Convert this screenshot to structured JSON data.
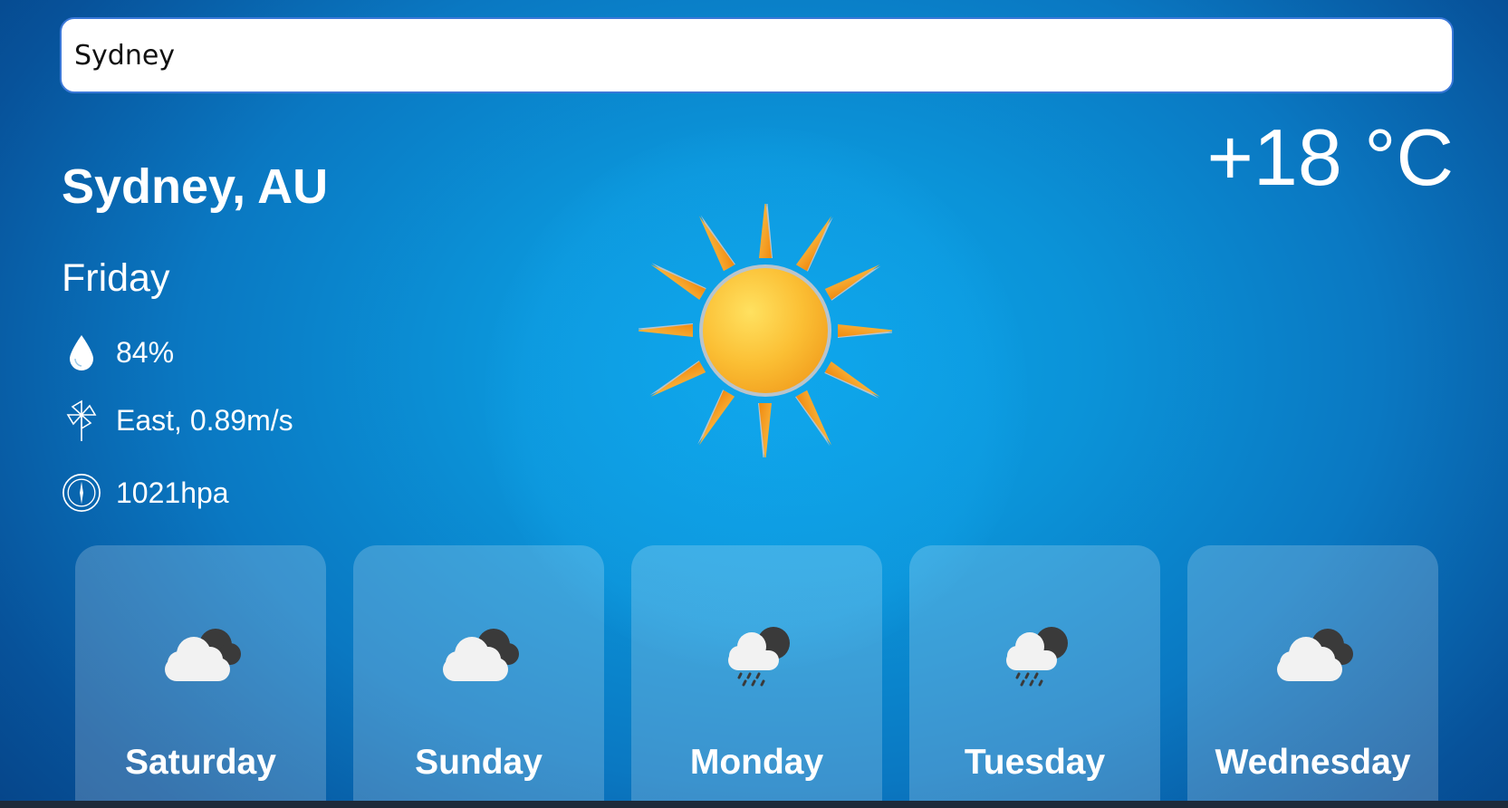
{
  "search": {
    "value": "Sydney",
    "placeholder": ""
  },
  "current": {
    "city": "Sydney, AU",
    "temperature": "+18 °C",
    "day": "Friday",
    "humidity": "84%",
    "wind": "East, 0.89m/s",
    "pressure": "1021hpa",
    "icon": "sun-icon"
  },
  "forecast": [
    {
      "day": "Saturday",
      "icon": "cloudy-icon"
    },
    {
      "day": "Sunday",
      "icon": "cloudy-icon"
    },
    {
      "day": "Monday",
      "icon": "rain-icon"
    },
    {
      "day": "Tuesday",
      "icon": "rain-icon"
    },
    {
      "day": "Wednesday",
      "icon": "cloudy-icon"
    }
  ],
  "colors": {
    "background": "#0a78c2",
    "sun": "#f7b52b",
    "rays": "#f49a1e"
  }
}
